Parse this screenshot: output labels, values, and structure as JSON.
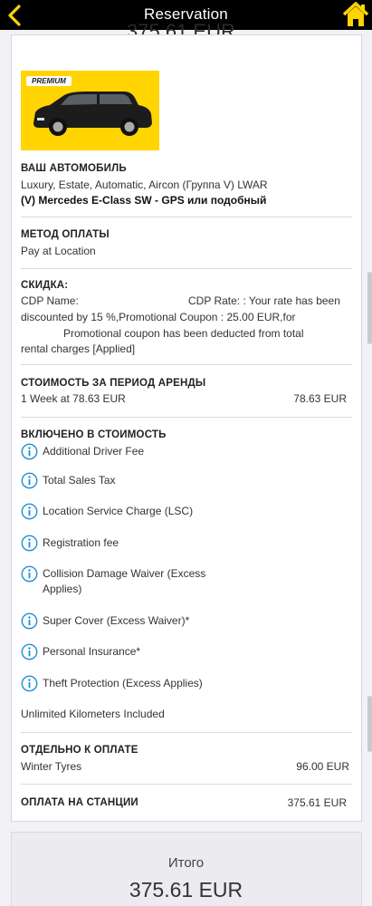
{
  "header": {
    "title": "Reservation",
    "back_icon": "chevron-left-icon",
    "home_icon": "home-icon",
    "accent": "#ffd400"
  },
  "cutoff_total": "375.61 EUR",
  "vehicle": {
    "badge": "PREMIUM",
    "heading": "ВАШ АВТОМОБИЛЬ",
    "description": "Luxury, Estate, Automatic, Aircon (Группа V) LWAR",
    "model": "(V) Mercedes E-Class SW - GPS или подобный"
  },
  "payment": {
    "heading": "МЕТОД ОПЛАТЫ",
    "value": "Pay at Location"
  },
  "discount": {
    "heading": "СКИДКА:",
    "line1_a": "CDP Name:",
    "line1_b": "CDP Rate: : Your rate has been",
    "line2": "discounted by 15 %,Promotional Coupon : 25.00 EUR,for",
    "line3": "Promotional coupon has been deducted from total",
    "line4": "rental charges [Applied]"
  },
  "rental": {
    "heading": "СТОИМОСТЬ ЗА ПЕРИОД АРЕНДЫ",
    "label": "1 Week at 78.63 EUR",
    "value": "78.63 EUR"
  },
  "included": {
    "heading": "ВКЛЮЧЕНО В СТОИМОСТЬ",
    "items": [
      {
        "label": "Additional Driver Fee"
      },
      {
        "label": "Total Sales Tax"
      },
      {
        "label": "Location Service Charge (LSC)"
      },
      {
        "label": "Registration fee"
      },
      {
        "label": "Collision Damage Waiver (Excess",
        "label2": "Applies)"
      },
      {
        "label": "Super Cover (Excess Waiver)*"
      },
      {
        "label": "Personal Insurance*"
      },
      {
        "label": "Theft Protection (Excess Applies)"
      }
    ],
    "unlimited": "Unlimited Kilometers Included",
    "info_icon": "info-circle-icon",
    "icon_color": "#1e8fd6"
  },
  "separate": {
    "heading": "ОТДЕЛЬНО К ОПЛАТЕ",
    "label": "Winter Tyres",
    "value": "96.00 EUR"
  },
  "station": {
    "heading": "ОПЛАТА НА СТАНЦИИ",
    "value": "375.61 EUR"
  },
  "total": {
    "label": "Итого",
    "value": "375.61 EUR"
  }
}
